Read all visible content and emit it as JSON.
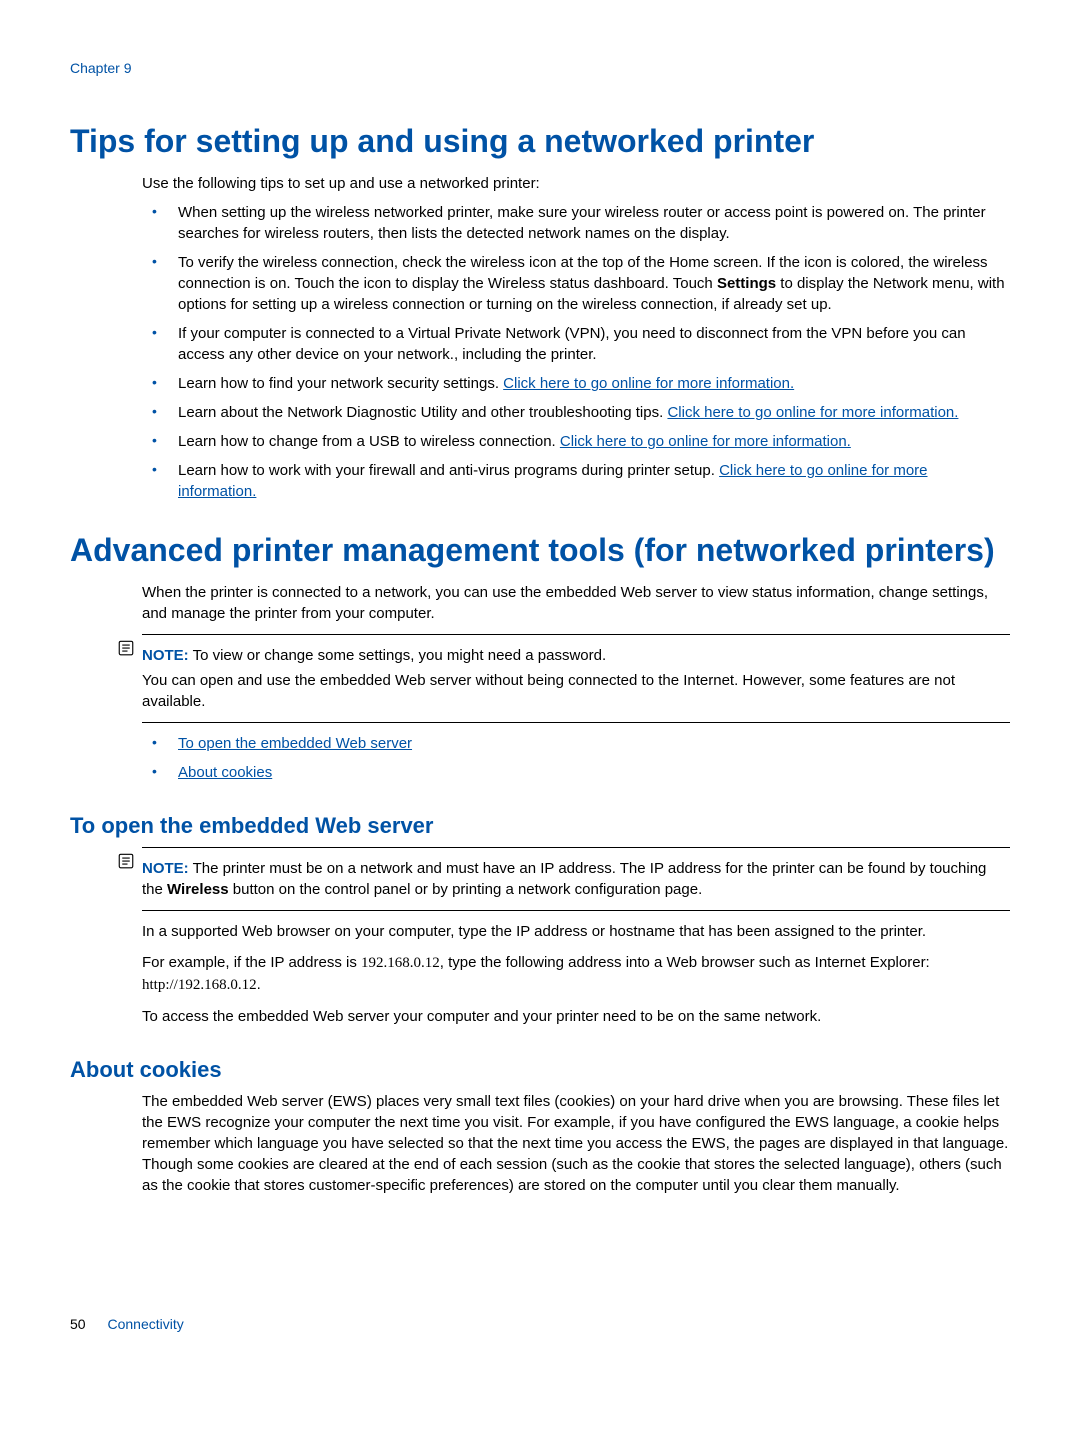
{
  "chapter": "Chapter 9",
  "h1_tips": "Tips for setting up and using a networked printer",
  "tips_intro": "Use the following tips to set up and use a networked printer:",
  "tips": [
    {
      "pre": "When setting up the wireless networked printer, make sure your wireless router or access point is powered on. The printer searches for wireless routers, then lists the detected network names on the display."
    },
    {
      "pre": "To verify the wireless connection, check the wireless icon at the top of the Home screen. If the icon is colored, the wireless connection is on. Touch the icon to display the Wireless status dashboard. Touch ",
      "bold": "Settings",
      "post": " to display the Network menu, with options for setting up a wireless connection or turning on the wireless connection, if already set up."
    },
    {
      "pre": "If your computer is connected to a Virtual Private Network (VPN), you need to disconnect from the VPN before you can access any other device on your network., including the printer."
    },
    {
      "pre": "Learn how to find your network security settings. ",
      "link": "Click here to go online for more information."
    },
    {
      "pre": "Learn about the Network Diagnostic Utility and other troubleshooting tips. ",
      "link": "Click here to go online for more information."
    },
    {
      "pre": "Learn how to change from a USB to wireless connection. ",
      "link": "Click here to go online for more information."
    },
    {
      "pre": "Learn how to work with your firewall and anti-virus programs during printer setup. ",
      "link": "Click here to go online for more information."
    }
  ],
  "h1_adv": "Advanced printer management tools (for networked printers)",
  "adv_intro": "When the printer is connected to a network, you can use the embedded Web server to view status information, change settings, and manage the printer from your computer.",
  "note1_label": "NOTE:",
  "note1_line1": "To view or change some settings, you might need a password.",
  "note1_line2": "You can open and use the embedded Web server without being connected to the Internet. However, some features are not available.",
  "toc": [
    "To open the embedded Web server",
    "About cookies"
  ],
  "h2_ews": "To open the embedded Web server",
  "note2_label": "NOTE:",
  "note2_pre": "The printer must be on a network and must have an IP address. The IP address for the printer can be found by touching the ",
  "note2_bold": "Wireless",
  "note2_post": " button on the control panel or by printing a network configuration page.",
  "ews_p1": "In a supported Web browser on your computer, type the IP address or hostname that has been assigned to the printer.",
  "ews_p2_pre": "For example, if the IP address is ",
  "ews_ip": "192.168.0.12",
  "ews_p2_mid": ", type the following address into a Web browser such as Internet Explorer: ",
  "ews_url": "http://192.168.0.12",
  "ews_p2_post": ".",
  "ews_p3": "To access the embedded Web server your computer and your printer need to be on the same network.",
  "h2_cookies": "About cookies",
  "cookies_p": "The embedded Web server (EWS) places very small text files (cookies) on your hard drive when you are browsing. These files let the EWS recognize your computer the next time you visit. For example, if you have configured the EWS language, a cookie helps remember which language you have selected so that the next time you access the EWS, the pages are displayed in that language. Though some cookies are cleared at the end of each session (such as the cookie that stores the selected language), others (such as the cookie that stores customer-specific preferences) are stored on the computer until you clear them manually.",
  "footer_page": "50",
  "footer_section": "Connectivity"
}
